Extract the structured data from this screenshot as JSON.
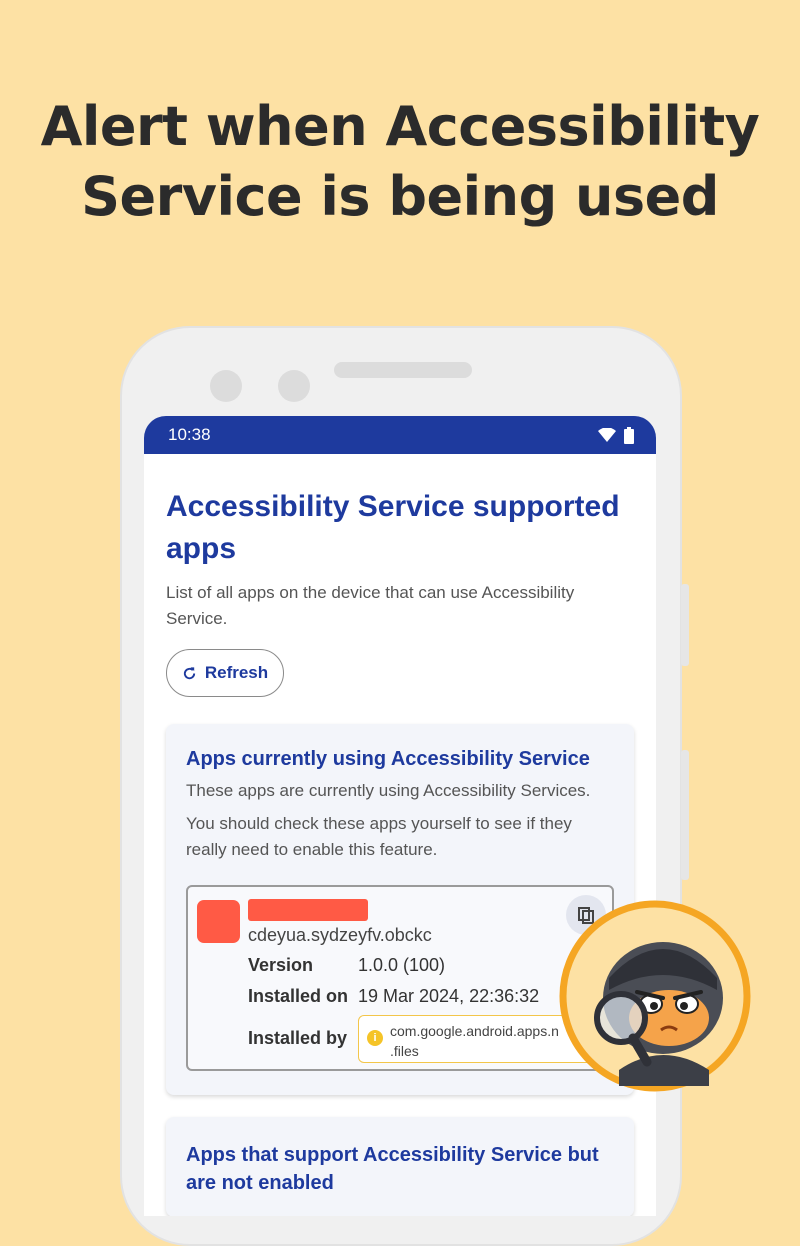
{
  "headline": {
    "line1": "Alert when Accessibility",
    "line2": "Service is being used"
  },
  "status_bar": {
    "time": "10:38",
    "icons": [
      "wifi-icon",
      "battery-icon"
    ]
  },
  "page": {
    "title": "Accessibility Service supported apps",
    "description": "List of all apps on the device that can use Accessibility Service.",
    "refresh_label": "Refresh",
    "refresh_icon": "refresh-icon"
  },
  "using_card": {
    "title": "Apps currently using Accessibility Service",
    "text1": "These apps are currently using Accessibility Services.",
    "text2": "You should check these apps yourself to see if they really need to enable this feature.",
    "app": {
      "package": "cdeyua.sydzeyfv.obckc",
      "version_label": "Version",
      "version_value": "1.0.0 (100)",
      "installed_on_label": "Installed on",
      "installed_on_value": "19 Mar 2024, 22:36:32",
      "installed_by_label": "Installed by",
      "installed_by_line1": "com.google.android.apps.n",
      "installed_by_line2": ".files"
    }
  },
  "supported_card": {
    "title": "Apps that support Accessibility Service but are not enabled"
  },
  "colors": {
    "background": "#FDE1A4",
    "accent": "#1E3A9E",
    "redacted": "#FF5A45",
    "mascot_ring": "#F5A623"
  }
}
